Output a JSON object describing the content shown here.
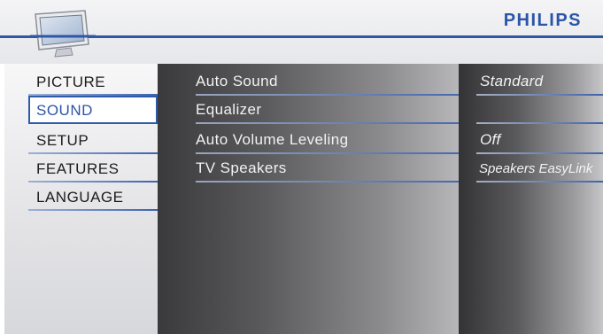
{
  "brand": "PHILIPS",
  "menu": {
    "items": [
      {
        "label": "PICTURE",
        "selected": false
      },
      {
        "label": "SOUND",
        "selected": true
      },
      {
        "label": "SETUP",
        "selected": false
      },
      {
        "label": "FEATURES",
        "selected": false
      },
      {
        "label": "LANGUAGE",
        "selected": false
      }
    ]
  },
  "submenu": {
    "items": [
      {
        "label": "Auto Sound",
        "value": "Standard"
      },
      {
        "label": "Equalizer",
        "value": ""
      },
      {
        "label": "Auto Volume Leveling",
        "value": "Off"
      },
      {
        "label": "TV Speakers",
        "value": "Speakers EasyLink"
      }
    ]
  },
  "colors": {
    "accent": "#2e5aa8",
    "brand": "#2b55a8",
    "selected_bg": "#ffffff"
  },
  "icons": {
    "header": "tv-icon"
  }
}
